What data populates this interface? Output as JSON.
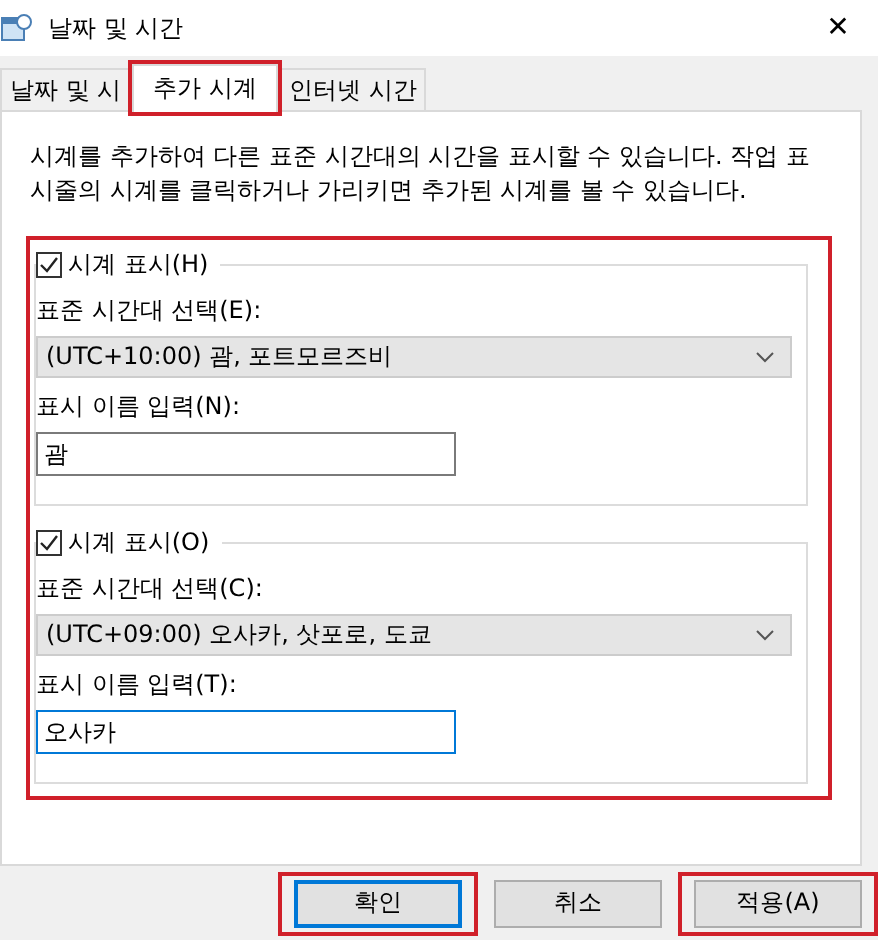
{
  "window": {
    "title": "날짜 및 시간",
    "close": "✕"
  },
  "tabs": [
    {
      "label": "날짜 및 시",
      "selected": false,
      "highlighted": false
    },
    {
      "label": "추가 시계",
      "selected": true,
      "highlighted": true
    },
    {
      "label": "인터넷 시간",
      "selected": false,
      "highlighted": false
    }
  ],
  "description": "시계를 추가하여 다른 표준 시간대의 시간을 표시할 수 있습니다. 작업 표시줄의 시계를 클릭하거나 가리키면 추가된 시계를 볼 수 있습니다.",
  "clocks_highlighted": true,
  "clocks": [
    {
      "checkbox_label": "시계 표시(H)",
      "checked": true,
      "timezone_label": "표준 시간대 선택(E):",
      "timezone": "(UTC+10:00) 괌, 포트모르즈비",
      "name_label": "표시 이름 입력(N):",
      "name": "괌",
      "focused": false
    },
    {
      "checkbox_label": "시계 표시(O)",
      "checked": true,
      "timezone_label": "표준 시간대 선택(C):",
      "timezone": "(UTC+09:00) 오사카, 삿포로, 도쿄",
      "name_label": "표시 이름 입력(T):",
      "name": "오사카",
      "focused": true
    }
  ],
  "buttons": [
    {
      "label": "확인",
      "default": true,
      "highlighted": true
    },
    {
      "label": "취소",
      "default": false,
      "highlighted": false
    },
    {
      "label": "적용(A)",
      "default": false,
      "highlighted": true
    }
  ]
}
